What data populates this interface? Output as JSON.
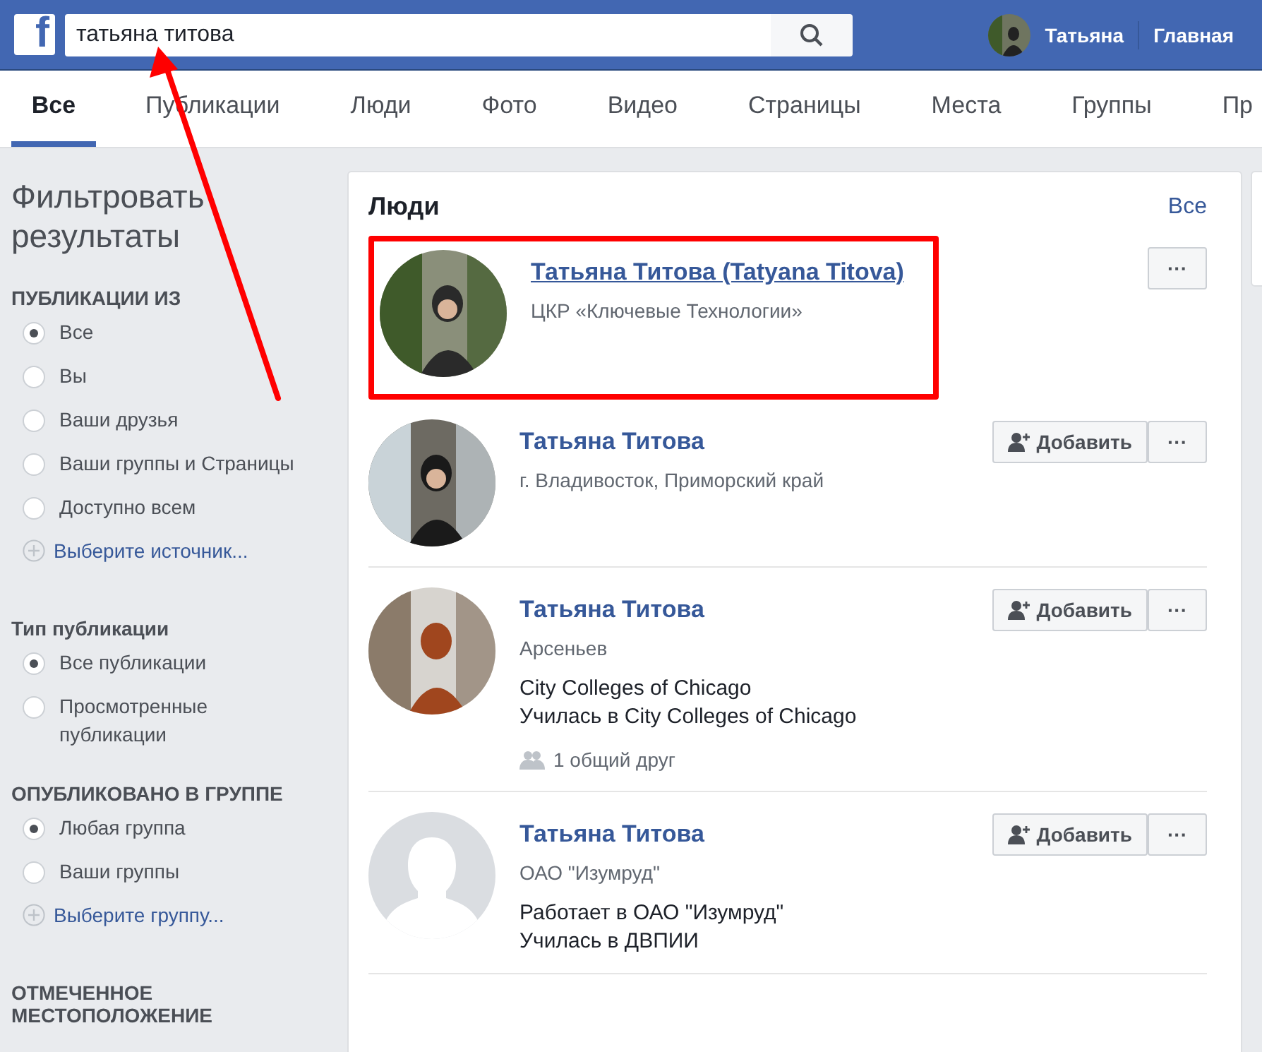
{
  "header": {
    "logo": "f",
    "search": {
      "value": "татьяна титова"
    },
    "profile_name": "Татьяна",
    "home": "Главная"
  },
  "tabs": [
    {
      "label": "Все",
      "selected": true
    },
    {
      "label": "Публикации",
      "selected": false
    },
    {
      "label": "Люди",
      "selected": false
    },
    {
      "label": "Фото",
      "selected": false
    },
    {
      "label": "Видео",
      "selected": false
    },
    {
      "label": "Страницы",
      "selected": false
    },
    {
      "label": "Места",
      "selected": false
    },
    {
      "label": "Группы",
      "selected": false
    },
    {
      "label": "Пр",
      "selected": false
    }
  ],
  "sidebar": {
    "title": "Фильтровать результаты",
    "sections": [
      {
        "heading": "ПУБЛИКАЦИИ ИЗ",
        "items": [
          {
            "kind": "radio",
            "label": "Все",
            "selected": true
          },
          {
            "kind": "radio",
            "label": "Вы",
            "selected": false
          },
          {
            "kind": "radio",
            "label": "Ваши друзья",
            "selected": false
          },
          {
            "kind": "radio",
            "label": "Ваши группы и Страницы",
            "selected": false
          },
          {
            "kind": "radio",
            "label": "Доступно всем",
            "selected": false
          },
          {
            "kind": "add",
            "label": "Выберите источник..."
          }
        ]
      },
      {
        "heading": "Тип публикации",
        "items": [
          {
            "kind": "radio",
            "label": "Все публикации",
            "selected": true
          },
          {
            "kind": "radio",
            "label": "Просмотренные публикации",
            "selected": false
          }
        ]
      },
      {
        "heading": "ОПУБЛИКОВАНО В ГРУППЕ",
        "items": [
          {
            "kind": "radio",
            "label": "Любая группа",
            "selected": true
          },
          {
            "kind": "radio",
            "label": "Ваши группы",
            "selected": false
          },
          {
            "kind": "add",
            "label": "Выберите группу..."
          }
        ]
      },
      {
        "heading": "ОТМЕЧЕННОЕ МЕСТОПОЛОЖЕНИЕ"
      }
    ]
  },
  "people": {
    "title": "Люди",
    "see_all": "Все",
    "rows": [
      {
        "name": "Татьяна Титова (Tatyana Titova)",
        "default_avatar": false,
        "highlighted": true,
        "more_label": "···",
        "subtitle": "ЦКР «Ключевые Технологии»"
      },
      {
        "name": "Татьяна Титова",
        "default_avatar": false,
        "highlighted": false,
        "add_label": "Добавить",
        "more_label": "···",
        "subtitle": "г. Владивосток, Приморский край"
      },
      {
        "name": "Татьяна Титова",
        "default_avatar": false,
        "highlighted": false,
        "add_label": "Добавить",
        "more_label": "···",
        "subtitle": "Арсеньев",
        "details": [
          "City Colleges of Chicago",
          "Училась в City Colleges of Chicago"
        ],
        "mutual": "1 общий друг"
      },
      {
        "name": "Татьяна Титова",
        "default_avatar": true,
        "highlighted": false,
        "add_label": "Добавить",
        "more_label": "···",
        "subtitle": "ОАО \"Изумруд\"",
        "details": [
          "Работает в ОАО \"Изумруд\"",
          "Училась в ДВПИИ"
        ]
      }
    ]
  },
  "annotation": {
    "arrow": true
  }
}
